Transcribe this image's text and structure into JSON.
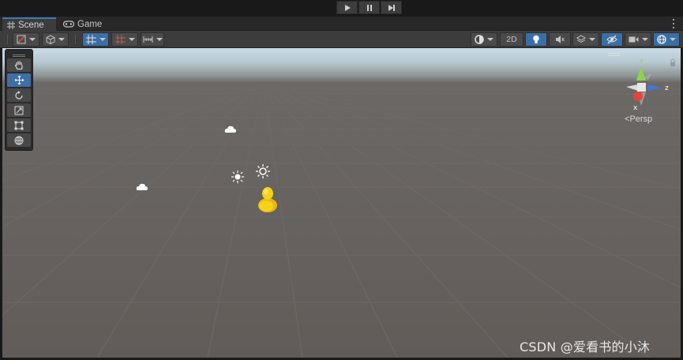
{
  "playbar": {
    "buttons": [
      "play",
      "pause",
      "step"
    ]
  },
  "tabs": [
    {
      "label": "Scene",
      "icon": "grid-icon",
      "active": true
    },
    {
      "label": "Game",
      "icon": "gamepad-icon",
      "active": false
    }
  ],
  "toolbar": {
    "mode_2d_label": "2D"
  },
  "tool_palette": [
    "hand-tool",
    "move-tool",
    "rotate-tool",
    "scale-tool",
    "rect-tool",
    "transform-tool"
  ],
  "active_tool": "move-tool",
  "gizmo": {
    "axis_y": "y",
    "axis_z": "z",
    "axis_x": "x",
    "projection_label": "Persp",
    "colors": {
      "y": "#8fd14f",
      "z": "#3f79d8",
      "x": "#e0463a"
    }
  },
  "watermark": "CSDN @爱看书的小沐",
  "colors": {
    "accent": "#3a79bb",
    "ground": "#625c59",
    "character": "#f5d11c"
  }
}
